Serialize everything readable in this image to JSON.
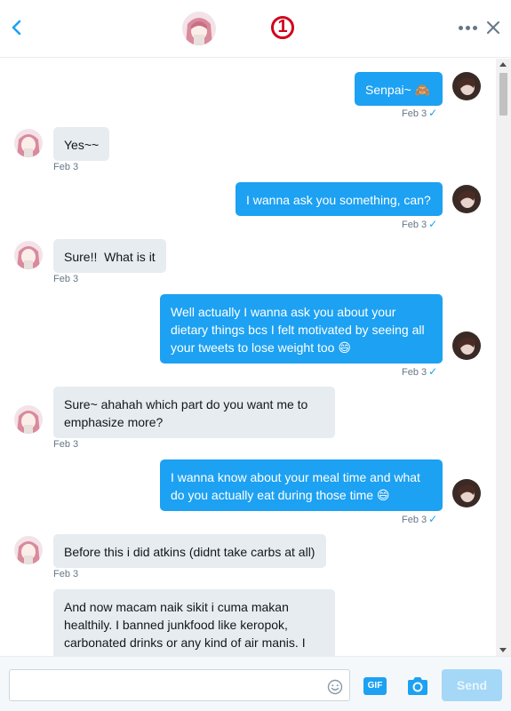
{
  "header": {
    "back_icon": "chevron-left-icon",
    "badge_text": "1",
    "more_icon": "more-dots-icon",
    "close_icon": "close-icon"
  },
  "messages": [
    {
      "direction": "out",
      "text": "Senpai~ 🙈",
      "time": "Feb 3"
    },
    {
      "direction": "in",
      "text": "Yes~~",
      "time": "Feb 3"
    },
    {
      "direction": "out",
      "text": "I wanna ask you something, can?",
      "time": "Feb 3"
    },
    {
      "direction": "in",
      "text": "Sure!!  What is it",
      "time": "Feb 3"
    },
    {
      "direction": "out",
      "text": "Well actually I wanna ask you about your dietary things bcs I felt motivated by seeing all your tweets to lose weight too 😄",
      "time": "Feb 3"
    },
    {
      "direction": "in",
      "text": "Sure~ ahahah which part do you want me to emphasize more?",
      "time": "Feb 3"
    },
    {
      "direction": "out",
      "text": "I wanna know about your meal time and what do you actually eat during those time 😄",
      "time": "Feb 3"
    },
    {
      "direction": "in",
      "text": "Before this i did atkins (didnt take carbs at all)",
      "time": "Feb 3"
    },
    {
      "direction": "in",
      "text": "And now macam naik sikit i cuma makan healthily. I banned junkfood like keropok, carbonated drinks or any kind of air manis.  I really dont like them. By this you can eat rice",
      "time": ""
    }
  ],
  "composer": {
    "input_value": "",
    "input_placeholder": "",
    "gif_label": "GIF",
    "send_label": "Send",
    "emoji_icon": "emoji-icon",
    "camera_icon": "camera-icon"
  },
  "colors": {
    "accent": "#1da1f2",
    "incoming_bubble": "#e6ecf0",
    "badge": "#d0021b",
    "send_disabled": "#a5d7f7"
  }
}
